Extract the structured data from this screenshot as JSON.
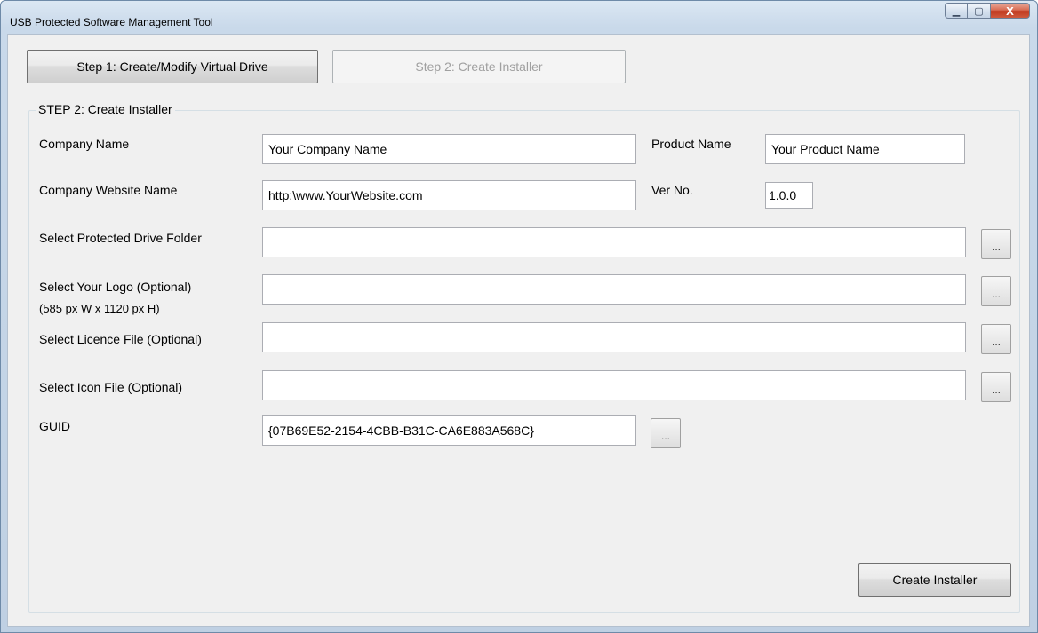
{
  "window": {
    "title": "USB Protected Software Management Tool",
    "min_glyph": "▁",
    "max_glyph": "▢",
    "close_glyph": "X"
  },
  "steps": {
    "step1_label": "Step 1: Create/Modify Virtual Drive",
    "step2_label": "Step 2: Create Installer"
  },
  "group": {
    "title": "STEP 2: Create Installer"
  },
  "form": {
    "company_name_label": "Company Name",
    "company_name_value": "Your Company Name",
    "product_name_label": "Product Name",
    "product_name_value": "Your Product Name",
    "website_label": "Company Website Name",
    "website_value": "http:\\www.YourWebsite.com",
    "version_label": "Ver No.",
    "version_value": "1.0.0",
    "drive_folder_label": "Select Protected Drive Folder",
    "drive_folder_value": "",
    "logo_label": "Select Your Logo (Optional)",
    "logo_hint": "(585 px W x 1120 px H)",
    "logo_value": "",
    "licence_label": "Select Licence File (Optional)",
    "licence_value": "",
    "icon_label": "Select Icon File (Optional)",
    "icon_value": "",
    "guid_label": "GUID",
    "guid_value": "{07B69E52-2154-4CBB-B31C-CA6E883A568C}",
    "browse_label": "..."
  },
  "actions": {
    "create_installer_label": "Create Installer"
  }
}
